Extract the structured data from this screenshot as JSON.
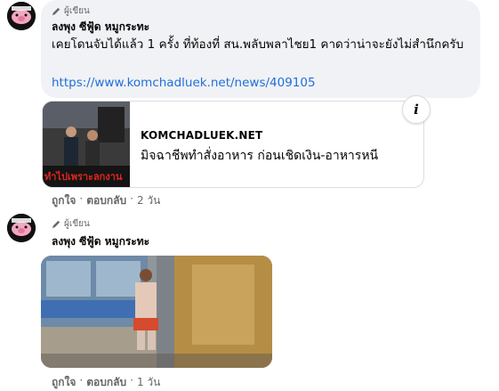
{
  "comments": [
    {
      "author_badge": "ผู้เขียน",
      "author_name": "ลงพุง ซีฟู้ด หมูกระทะ",
      "text": "เคยโดนจับได้แล้ว 1 ครั้ง ที่ท้องที่ สน.พลับพลาไชย1 คาดว่าน่าจะยังไม่สำนึกครับ",
      "link": "https://www.komchadluek.net/news/409105",
      "link_preview": {
        "domain": "KOMCHADLUEK.NET",
        "title": "มิจฉาชีพทำสั่งอาหาร ก่อนเชิดเงิน-อาหารหนี",
        "thumb_caption": "ทำไปเพราะลกงาน"
      },
      "info_icon": "info-icon",
      "actions": {
        "like": "ถูกใจ",
        "reply": "ตอบกลับ",
        "time": "2 วัน"
      }
    },
    {
      "author_badge": "ผู้เขียน",
      "author_name": "ลงพุง ซีฟู้ด หมูกระทะ",
      "photo_alt": "cctv-photo",
      "actions": {
        "like": "ถูกใจ",
        "reply": "ตอบกลับ",
        "time": "1 วัน"
      }
    }
  ],
  "separator": "·",
  "colors": {
    "link": "#216fdb",
    "bubble": "#f0f2f5",
    "meta": "#65676b"
  }
}
